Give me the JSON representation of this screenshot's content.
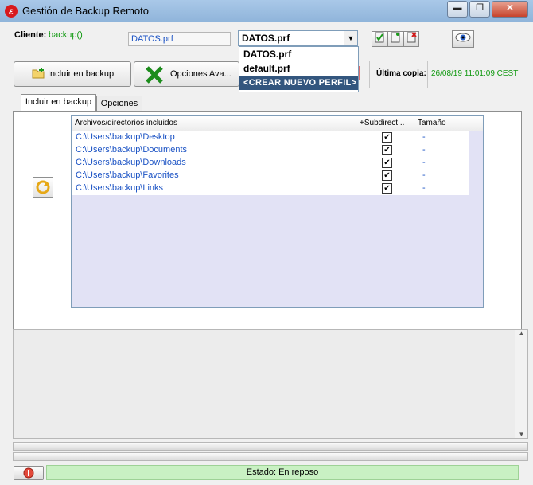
{
  "window": {
    "title": "Gestión de Backup Remoto",
    "minimize": "▬",
    "maximize": "❐",
    "close": "✕"
  },
  "client": {
    "label": "Cliente:",
    "value": "backup()",
    "profile_field": "DATOS.prf",
    "profile_select": "DATOS.prf",
    "options": [
      "DATOS.prf",
      "default.prf",
      "<CREAR NUEVO PERFIL>"
    ],
    "selected_option_index": 2
  },
  "toolbar": {
    "include_label": "Incluir en backup",
    "advanced_label": "Opciones Ava...",
    "last_copy_label": "Última copia:",
    "last_copy_value": "26/08/19 11:01:09 CEST"
  },
  "tabs": [
    {
      "label": "Incluir en backup",
      "active": true
    },
    {
      "label": "Opciones",
      "active": false
    }
  ],
  "list": {
    "columns": [
      "Archivos/directorios incluidos",
      "+Subdirect...",
      "Tamaño"
    ],
    "rows": [
      {
        "path": "C:\\Users\\backup\\Desktop",
        "subdirs": true,
        "size": "-"
      },
      {
        "path": "C:\\Users\\backup\\Documents",
        "subdirs": true,
        "size": "-"
      },
      {
        "path": "C:\\Users\\backup\\Downloads",
        "subdirs": true,
        "size": "-"
      },
      {
        "path": "C:\\Users\\backup\\Favorites",
        "subdirs": true,
        "size": "-"
      },
      {
        "path": "C:\\Users\\backup\\Links",
        "subdirs": true,
        "size": "-"
      }
    ]
  },
  "status": {
    "text": "Estado: En reposo"
  },
  "colors": {
    "accent_green": "#129a12",
    "link_blue": "#1a52c4",
    "status_bg": "#c9f1c3",
    "dropdown_selected": "#33567e"
  }
}
